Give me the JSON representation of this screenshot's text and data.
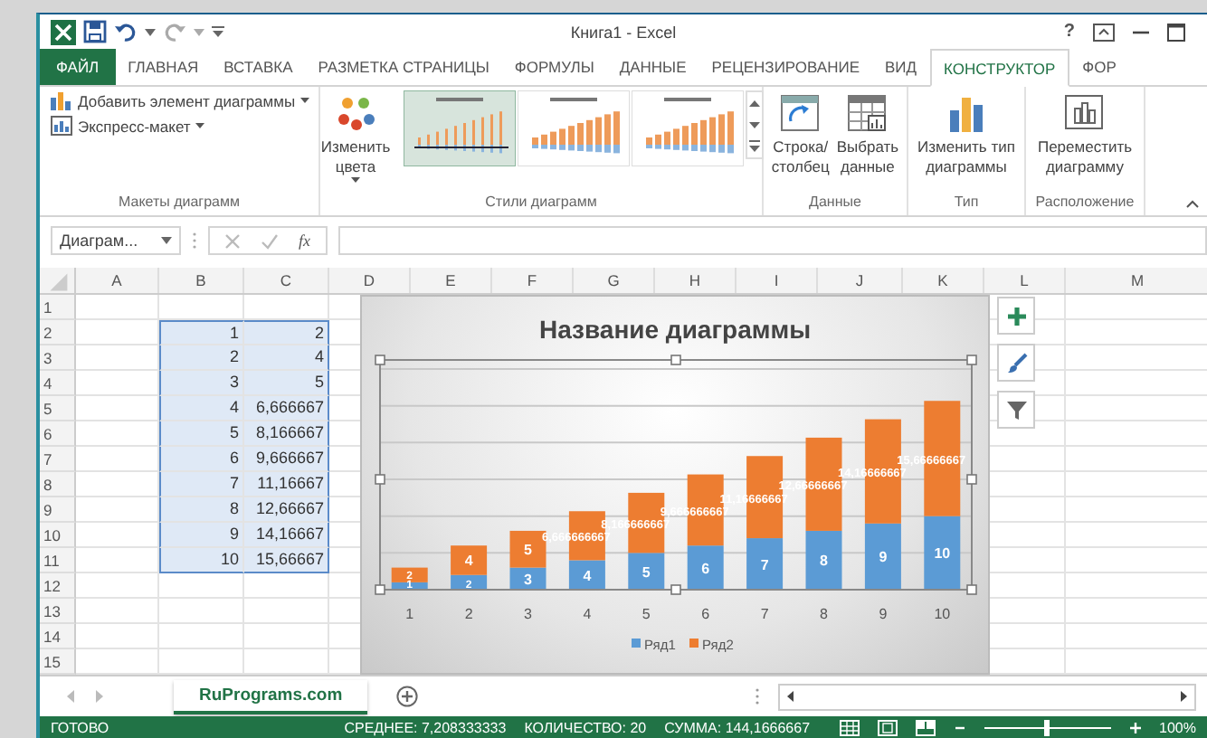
{
  "window": {
    "title": "Книга1 - Excel",
    "help": "?"
  },
  "tabs": [
    {
      "label": "ФАЙЛ",
      "kind": "file",
      "selected": false
    },
    {
      "label": "ГЛАВНАЯ",
      "kind": "tab",
      "selected": false
    },
    {
      "label": "ВСТАВКА",
      "kind": "tab",
      "selected": false
    },
    {
      "label": "РАЗМЕТКА СТРАНИЦЫ",
      "kind": "tab",
      "selected": false
    },
    {
      "label": "ФОРМУЛЫ",
      "kind": "tab",
      "selected": false
    },
    {
      "label": "ДАННЫЕ",
      "kind": "tab",
      "selected": false
    },
    {
      "label": "РЕЦЕНЗИРОВАНИЕ",
      "kind": "tab",
      "selected": false
    },
    {
      "label": "ВИД",
      "kind": "tab",
      "selected": false
    },
    {
      "label": "КОНСТРУКТОР",
      "kind": "tab",
      "selected": true
    },
    {
      "label": "ФОР",
      "kind": "tab",
      "selected": false
    }
  ],
  "ribbon": {
    "groups": [
      {
        "label": "Макеты диаграмм",
        "items": [
          {
            "kind": "small",
            "label": "Добавить элемент диаграммы"
          },
          {
            "kind": "small",
            "label": "Экспресс-макет"
          }
        ]
      },
      {
        "label": "Стили диаграмм",
        "items": [
          {
            "kind": "large",
            "lines": [
              "Изменить",
              "цвета"
            ],
            "dropdown": true
          },
          {
            "kind": "gallery",
            "styles": [
              {
                "selected": true
              },
              {
                "selected": false
              },
              {
                "selected": false
              }
            ]
          }
        ]
      },
      {
        "label": "Данные",
        "items": [
          {
            "kind": "large",
            "lines": [
              "Строка/",
              "столбец"
            ],
            "dropdown": false
          },
          {
            "kind": "large",
            "lines": [
              "Выбрать",
              "данные"
            ],
            "dropdown": false
          }
        ]
      },
      {
        "label": "Тип",
        "items": [
          {
            "kind": "large",
            "lines": [
              "Изменить тип",
              "диаграммы"
            ],
            "dropdown": false
          }
        ]
      },
      {
        "label": "Расположение",
        "items": [
          {
            "kind": "large",
            "lines": [
              "Переместить",
              "диаграмму"
            ],
            "dropdown": false
          }
        ]
      }
    ]
  },
  "formula_bar": {
    "name_box": "Диаграм...",
    "function_button": "fx"
  },
  "sheet": {
    "columns": [
      "A",
      "B",
      "C",
      "D",
      "E",
      "F",
      "G",
      "H",
      "I",
      "J",
      "K",
      "L",
      "M"
    ],
    "rows": [
      {
        "number": "1",
        "selected": false
      },
      {
        "number": "2",
        "b": "1",
        "c": "2",
        "selected": true
      },
      {
        "number": "3",
        "b": "2",
        "c": "4",
        "selected": true
      },
      {
        "number": "4",
        "b": "3",
        "c": "5",
        "selected": true
      },
      {
        "number": "5",
        "b": "4",
        "c": "6,666667",
        "selected": true
      },
      {
        "number": "6",
        "b": "5",
        "c": "8,166667",
        "selected": true
      },
      {
        "number": "7",
        "b": "6",
        "c": "9,666667",
        "selected": true
      },
      {
        "number": "8",
        "b": "7",
        "c": "11,16667",
        "selected": true
      },
      {
        "number": "9",
        "b": "8",
        "c": "12,66667",
        "selected": true
      },
      {
        "number": "10",
        "b": "9",
        "c": "14,16667",
        "selected": true
      },
      {
        "number": "11",
        "b": "10",
        "c": "15,66667",
        "selected": true
      },
      {
        "number": "12",
        "selected": false
      },
      {
        "number": "13",
        "selected": false
      },
      {
        "number": "14",
        "selected": false
      },
      {
        "number": "15",
        "selected": false
      }
    ]
  },
  "chart": {
    "title": "Название диаграммы",
    "chart_data": {
      "type": "bar",
      "stacked": true,
      "categories": [
        "1",
        "2",
        "3",
        "4",
        "5",
        "6",
        "7",
        "8",
        "9",
        "10"
      ],
      "ylim": [
        0,
        30
      ],
      "data_labels": true,
      "legend": "bottom",
      "series": [
        {
          "name": "Ряд1",
          "color": "#5b9bd5",
          "values": [
            1,
            2,
            3,
            4,
            5,
            6,
            7,
            8,
            9,
            10
          ],
          "value_labels": [
            "1",
            "2",
            "3",
            "4",
            "5",
            "6",
            "7",
            "8",
            "9",
            "10"
          ]
        },
        {
          "name": "Ряд2",
          "color": "#ed7d31",
          "values": [
            2,
            4,
            5,
            6.666666667,
            8.166666667,
            9.666666667,
            11.16666667,
            12.66666667,
            14.16666667,
            15.66666667
          ],
          "value_labels": [
            "2",
            "4",
            "5",
            "6,666666667",
            "8,166666667",
            "9,666666667",
            "11,16666667",
            "12,66666667",
            "14,16666667",
            "15,66666667"
          ]
        }
      ]
    }
  },
  "sheet_tabs": [
    {
      "label": "RuPrograms.com",
      "selected": true
    }
  ],
  "status_bar": {
    "mode": "ГОТОВО",
    "average": "СРЕДНЕЕ: 7,208333333",
    "count": "КОЛИЧЕСТВО: 20",
    "sum": "СУММА: 144,1666667",
    "zoom": "100%",
    "zoom_slider": {
      "level": 0.5
    }
  }
}
